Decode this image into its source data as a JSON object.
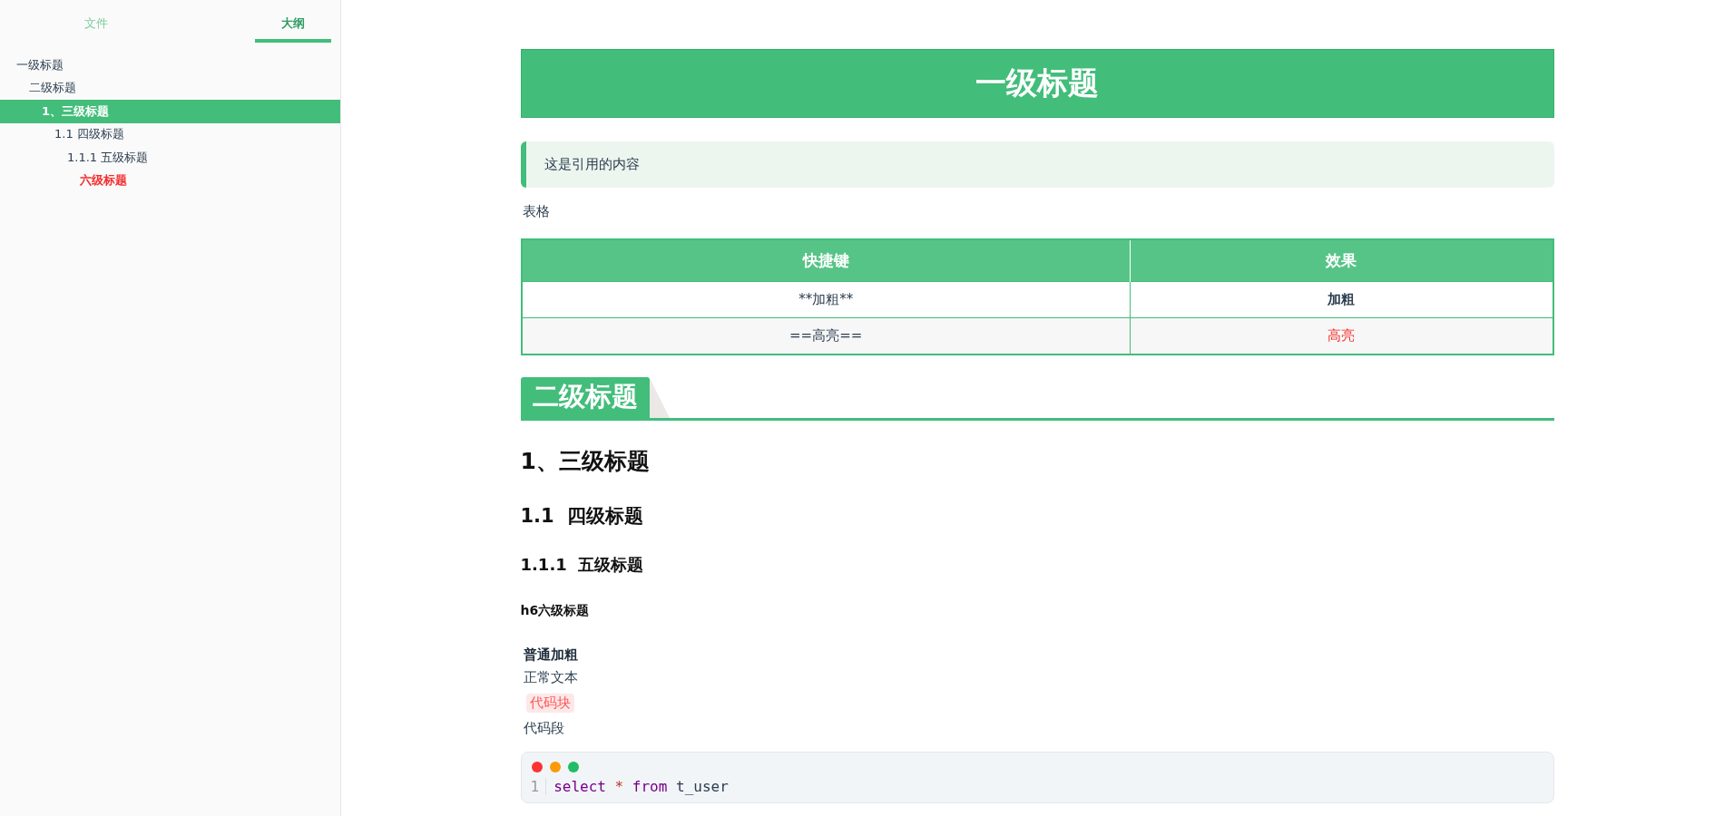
{
  "sidebar": {
    "tabs": [
      {
        "label": "文件",
        "selected": false
      },
      {
        "label": "大纲",
        "selected": true
      }
    ],
    "outline": [
      {
        "label": "一级标题",
        "selected": false,
        "children": [
          {
            "label": "二级标题",
            "selected": false,
            "children": [
              {
                "label": "1、三级标题",
                "selected": true,
                "children": [
                  {
                    "label": "1.1 四级标题",
                    "selected": false,
                    "children": [
                      {
                        "label": "1.1.1 五级标题",
                        "selected": false,
                        "children": [
                          {
                            "label": "六级标题",
                            "selected": false
                          }
                        ]
                      }
                    ]
                  }
                ]
              }
            ]
          }
        ]
      }
    ]
  },
  "document": {
    "h1": "一级标题",
    "blockquote": "这是引用的内容",
    "table_caption": "表格",
    "table": {
      "columns": [
        "快捷键",
        "效果"
      ],
      "rows": [
        [
          {
            "text": "**加粗**",
            "kind": "plain"
          },
          {
            "text": "加粗",
            "kind": "bold"
          }
        ],
        [
          {
            "text": "==高亮==",
            "kind": "plain"
          },
          {
            "text": "高亮",
            "kind": "highlight"
          }
        ]
      ]
    },
    "h2": "二级标题",
    "h3": "1、三级标题",
    "h4": "1.1  四级标题",
    "h5": "1.1.1  五级标题",
    "h6": "h6六级标题",
    "bold_text": "普通加粗",
    "normal_text": "正常文本",
    "inline_code": "代码块",
    "code_label": "代码段",
    "code_block": {
      "lines": [
        {
          "number": "1",
          "tokens": [
            {
              "text": "select",
              "kind": "keyword"
            },
            {
              "text": " *",
              "kind": "operator"
            },
            {
              "text": " from",
              "kind": "keyword"
            },
            {
              "text": " t_user",
              "kind": "plain"
            }
          ]
        }
      ]
    }
  }
}
